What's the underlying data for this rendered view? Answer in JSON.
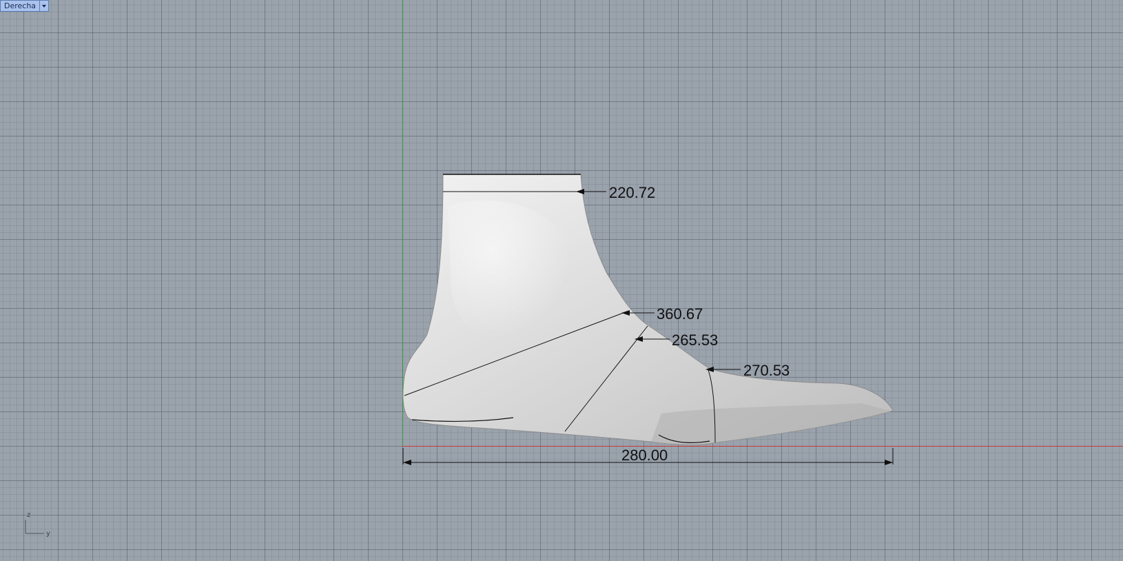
{
  "viewport": {
    "view_name": "Derecha"
  },
  "dimensions": {
    "top_girth": "220.72",
    "instep_girth": "360.67",
    "waist_girth": "265.53",
    "ball_girth": "270.53",
    "length": "280.00"
  },
  "axis_icon": {
    "vertical_label": "z",
    "horizontal_label": "y"
  },
  "colors": {
    "grid_background": "#9aa2ac",
    "y_axis": "#2f9a38",
    "x_axis": "#c23b3b",
    "view_tab": "#a9c3ec"
  }
}
